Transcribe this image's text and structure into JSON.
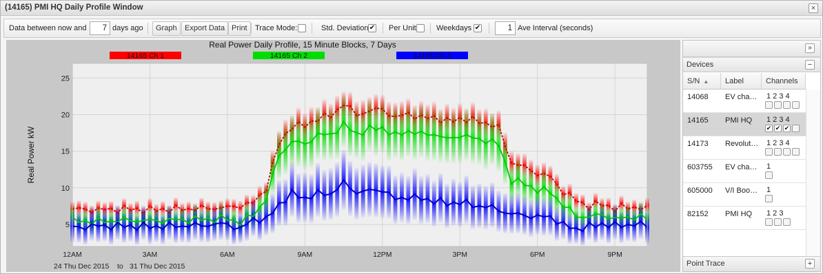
{
  "window": {
    "title": "(14165) PMI HQ Daily Profile Window",
    "close_label": "×"
  },
  "toolbar": {
    "data_between_label": "Data between now and",
    "days_value": "7",
    "days_ago_label": "days ago",
    "graph_button": "Graph",
    "export_button": "Export Data",
    "print_button": "Print",
    "trace_mode_label": "Trace Mode:",
    "trace_mode_checked": false,
    "std_dev_label": "Std. Deviation",
    "std_dev_checked": true,
    "per_unit_label": "Per Unit",
    "per_unit_checked": false,
    "weekdays_label": "Weekdays",
    "weekdays_checked": true,
    "interval_value": "1",
    "interval_label": "Ave Interval (seconds)",
    "check_mark": "✔"
  },
  "chart_data": {
    "type": "line",
    "title": "Real Power Daily Profile, 15 Minute Blocks, 7 Days",
    "ylabel": "Real Power kW",
    "xlabel": "",
    "ylim": [
      2,
      27
    ],
    "xlim": [
      0,
      22.25
    ],
    "x_tick_labels": [
      "12AM",
      "3AM",
      "6AM",
      "9AM",
      "12PM",
      "3PM",
      "6PM",
      "9PM"
    ],
    "x_tick_hours": [
      0,
      3,
      6,
      9,
      12,
      15,
      18,
      21
    ],
    "y_ticks": [
      5,
      10,
      15,
      20,
      25
    ],
    "date_range": {
      "from": "24 Thu Dec 2015",
      "to_label": "to",
      "to": "31 Thu Dec 2015"
    },
    "grid": true,
    "legend_position": "top",
    "series": [
      {
        "name": "14165 Ch 1",
        "color": "#ff0000",
        "dash": true,
        "keys": [
          [
            0,
            7.1
          ],
          [
            1,
            7.0
          ],
          [
            2,
            7.1
          ],
          [
            3,
            7.0
          ],
          [
            4,
            7.1
          ],
          [
            5,
            7.2
          ],
          [
            6,
            7.3
          ],
          [
            6.5,
            7.6
          ],
          [
            7,
            7.9
          ],
          [
            7.5,
            10
          ],
          [
            8,
            16
          ],
          [
            8.5,
            18.5
          ],
          [
            9,
            18.5
          ],
          [
            9.5,
            19.5
          ],
          [
            10,
            19.8
          ],
          [
            10.5,
            21.5
          ],
          [
            11,
            20
          ],
          [
            11.5,
            20.5
          ],
          [
            12,
            20.8
          ],
          [
            12.5,
            19.5
          ],
          [
            13,
            20.2
          ],
          [
            13.5,
            19.5
          ],
          [
            14,
            19.7
          ],
          [
            14.5,
            19.0
          ],
          [
            15,
            19.5
          ],
          [
            15.5,
            19.2
          ],
          [
            16,
            18.9
          ],
          [
            16.5,
            18.2
          ],
          [
            17,
            13.5
          ],
          [
            17.5,
            12.8
          ],
          [
            18,
            12.0
          ],
          [
            18.5,
            11.5
          ],
          [
            19,
            9.5
          ],
          [
            19.5,
            8.3
          ],
          [
            20,
            7.5
          ],
          [
            20.5,
            7.8
          ],
          [
            21,
            7.2
          ],
          [
            21.5,
            7.4
          ],
          [
            22,
            7.3
          ],
          [
            22.25,
            7.1
          ]
        ]
      },
      {
        "name": "14165 Ch 2",
        "color": "#00dd00",
        "dash": false,
        "keys": [
          [
            0,
            5.5
          ],
          [
            1,
            5.4
          ],
          [
            2,
            5.6
          ],
          [
            3,
            5.5
          ],
          [
            4,
            5.6
          ],
          [
            5,
            5.7
          ],
          [
            6,
            5.8
          ],
          [
            6.5,
            5.3
          ],
          [
            7,
            6.3
          ],
          [
            7.5,
            8.5
          ],
          [
            8,
            14.5
          ],
          [
            8.5,
            16.3
          ],
          [
            9,
            16.0
          ],
          [
            9.5,
            17.2
          ],
          [
            10,
            17.3
          ],
          [
            10.5,
            18.6
          ],
          [
            11,
            17.4
          ],
          [
            11.5,
            18.0
          ],
          [
            12,
            18.2
          ],
          [
            12.5,
            17.1
          ],
          [
            13,
            17.8
          ],
          [
            13.5,
            17.3
          ],
          [
            14,
            17.4
          ],
          [
            14.5,
            16.6
          ],
          [
            15,
            17.2
          ],
          [
            15.5,
            16.8
          ],
          [
            16,
            16.5
          ],
          [
            16.5,
            15.9
          ],
          [
            17,
            11.0
          ],
          [
            17.5,
            10.6
          ],
          [
            18,
            9.7
          ],
          [
            18.5,
            9.5
          ],
          [
            19,
            7.6
          ],
          [
            19.5,
            6.2
          ],
          [
            20,
            6.0
          ],
          [
            20.5,
            6.4
          ],
          [
            21,
            5.7
          ],
          [
            21.5,
            6.0
          ],
          [
            22,
            6.0
          ],
          [
            22.25,
            5.8
          ]
        ]
      },
      {
        "name": "14165 Ch 3",
        "color": "#0000ff",
        "dash": false,
        "keys": [
          [
            0,
            4.6
          ],
          [
            1,
            4.8
          ],
          [
            2,
            4.8
          ],
          [
            3,
            4.7
          ],
          [
            4,
            4.8
          ],
          [
            5,
            4.9
          ],
          [
            6,
            5.1
          ],
          [
            6.5,
            4.3
          ],
          [
            7,
            5.8
          ],
          [
            7.5,
            5.6
          ],
          [
            8,
            7.8
          ],
          [
            8.5,
            9.2
          ],
          [
            9,
            8.6
          ],
          [
            9.5,
            9.2
          ],
          [
            10,
            9.2
          ],
          [
            10.5,
            10.7
          ],
          [
            11,
            9.4
          ],
          [
            11.5,
            9.6
          ],
          [
            12,
            9.8
          ],
          [
            12.5,
            8.4
          ],
          [
            13,
            8.8
          ],
          [
            13.5,
            8.5
          ],
          [
            14,
            8.3
          ],
          [
            14.5,
            7.8
          ],
          [
            15,
            8.1
          ],
          [
            15.5,
            7.6
          ],
          [
            16,
            7.5
          ],
          [
            16.5,
            7.0
          ],
          [
            17,
            6.4
          ],
          [
            17.5,
            6.3
          ],
          [
            18,
            6.0
          ],
          [
            18.5,
            6.1
          ],
          [
            19,
            4.9
          ],
          [
            19.5,
            4.4
          ],
          [
            20,
            4.7
          ],
          [
            20.5,
            5.1
          ],
          [
            21,
            4.8
          ],
          [
            21.5,
            5.0
          ],
          [
            22,
            5.0
          ],
          [
            22.25,
            4.8
          ]
        ]
      }
    ]
  },
  "sidebar": {
    "collapse_icon": "»",
    "devices_title": "Devices",
    "devices_toggle": "−",
    "columns": {
      "sn": "S/N",
      "sort_arrow": "▲",
      "label": "Label",
      "channels": "Channels"
    },
    "devices": [
      {
        "sn": "14068",
        "label": "EV cha…",
        "channels": "1 2 3 4",
        "nch": 4,
        "checked": [
          false,
          false,
          false,
          false
        ],
        "selected": false
      },
      {
        "sn": "14165",
        "label": "PMI HQ",
        "channels": "1 2 3 4",
        "nch": 4,
        "checked": [
          true,
          true,
          true,
          false
        ],
        "selected": true
      },
      {
        "sn": "14173",
        "label": "Revolut…",
        "channels": "1 2 3 4",
        "nch": 4,
        "checked": [
          false,
          false,
          false,
          false
        ],
        "selected": false
      },
      {
        "sn": "603755",
        "label": "EV cha…",
        "channels": "1",
        "nch": 1,
        "checked": [
          false
        ],
        "selected": false
      },
      {
        "sn": "605000",
        "label": "V/I Boo…",
        "channels": "1",
        "nch": 1,
        "checked": [
          false
        ],
        "selected": false
      },
      {
        "sn": "82152",
        "label": "PMI HQ",
        "channels": "1 2 3",
        "nch": 3,
        "checked": [
          false,
          false,
          false
        ],
        "selected": false
      }
    ],
    "point_trace_title": "Point Trace",
    "point_trace_toggle": "+"
  }
}
